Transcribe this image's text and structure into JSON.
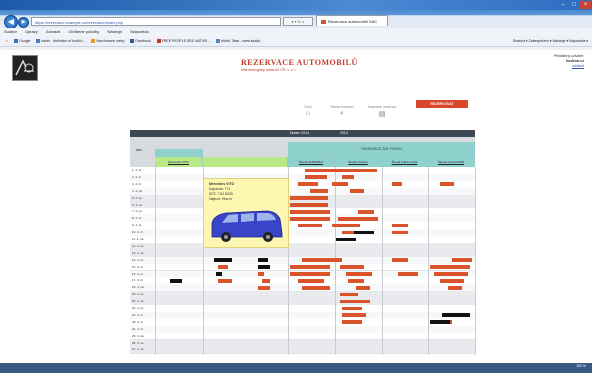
{
  "browser": {
    "url": "https://rezervace.example.cz/rezervace/index.php",
    "tab_title": "Rezervace automobilů SAC",
    "menu": [
      "Soubor",
      "Úpravy",
      "Zobrazit",
      "Oblíbené položky",
      "Nástroje",
      "Nápověda"
    ],
    "favorites": [
      {
        "label": "Google",
        "color": "#3a6fc4"
      },
      {
        "label": "kariér - definition of build b...",
        "color": "#4d7cc7"
      },
      {
        "label": "Navrhované weby",
        "color": "#e0a020"
      },
      {
        "label": "Facebook",
        "color": "#3b5998"
      },
      {
        "label": "FREE PEOPLE SEE NATIVE...",
        "color": "#c0392b"
      },
      {
        "label": "eMail: Tatar - www.studia",
        "color": "#5588bb"
      }
    ],
    "command_bar": "Stránka ▾  Zabezpečení ▾  Nástroje ▾  Nápověda ▾",
    "zoom": "100 %"
  },
  "header": {
    "title": "Rezervace automobilů",
    "subtitle": "Mikrobiologický ústav AV ČR, v. v. i.",
    "user_line1": "Přihlášený uživatel:",
    "user_line2": "hostivar.cz",
    "logout": "odhlásit"
  },
  "toolbar": {
    "home": "Úvod",
    "search": "Hledat rezervaci",
    "pending": "Neproduk. rezervací",
    "new_button": "REZERVOVAT"
  },
  "grid": {
    "month_label": "Duben 2014",
    "month_nav": "2014",
    "date_header": "den",
    "group_label": "REZERVACE ZDE POSLÍN",
    "cars": [
      "Mercedes VITO",
      "Škoda SUPERB 2",
      "Škoda Octavia",
      "Škoda Fabia combi",
      "Škoda Octavia RS5"
    ],
    "days": [
      "1. 4. út",
      "2. 4. st",
      "3. 4. čt",
      "4. 4. pá",
      "5. 4. so",
      "6. 4. ne",
      "7. 4. po",
      "8. 4. út",
      "9. 4. st",
      "10. 4. čt",
      "11. 4. pá",
      "12. 4. so",
      "13. 4. ne",
      "14. 4. po",
      "15. 4. út",
      "16. 4. st",
      "17. 4. čt",
      "18. 4. pá",
      "19. 4. so",
      "20. 4. ne",
      "21. 4. po",
      "22. 4. út",
      "23. 4. st",
      "24. 4. čt",
      "25. 4. pá",
      "26. 4. so",
      "27. 4. ne"
    ]
  },
  "popup": {
    "car": "Mercedes VITO",
    "capacity": "Kapacita: 7+1",
    "spz": "SPZ: 7A3 8339",
    "mileage": "Nájezd: Hlavní"
  },
  "colors": {
    "booking": "#d9542b",
    "booking_own": "#111111",
    "header_dark": "#3e4854",
    "teal": "#8fd1cc",
    "selected_car": "#b8e986",
    "weekend": "#e8eaed",
    "brand_red": "#c0392b"
  }
}
